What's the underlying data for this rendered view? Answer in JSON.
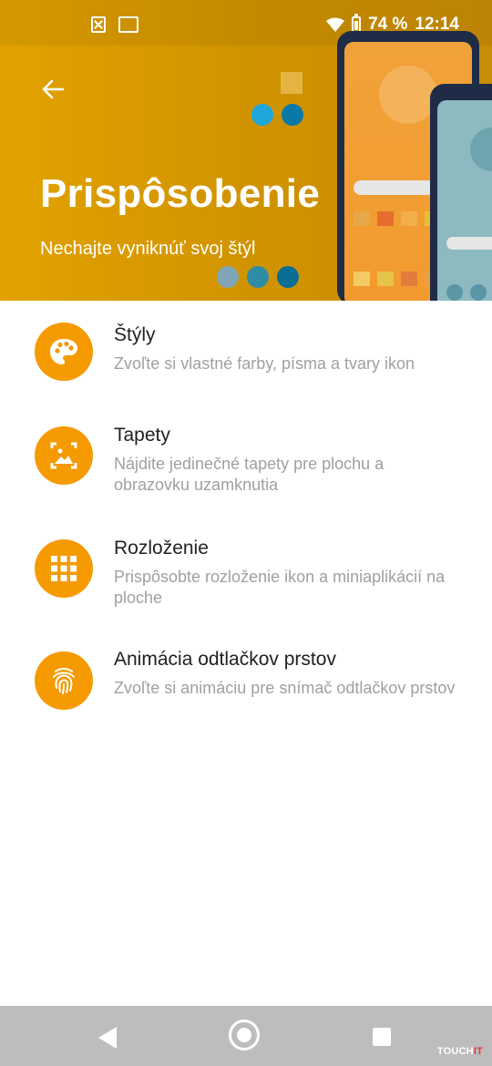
{
  "status": {
    "battery": "74 %",
    "time": "12:14"
  },
  "header": {
    "title": "Prispôsobenie",
    "subtitle": "Nechajte vyniknúť svoj štýl"
  },
  "items": [
    {
      "title": "Štýly",
      "desc": "Zvoľte si vlastné farby, písma a tvary ikon",
      "icon": "palette-icon"
    },
    {
      "title": "Tapety",
      "desc": "Nájdite jedinečné tapety pre plochu a obrazovku uzamknutia",
      "icon": "wallpaper-icon"
    },
    {
      "title": "Rozloženie",
      "desc": "Prispôsobte rozloženie ikon a miniaplikácií na ploche",
      "icon": "grid-icon"
    },
    {
      "title": "Animácia odtlačkov prstov",
      "desc": "Zvoľte si animáciu pre snímač odtlačkov prstov",
      "icon": "fingerprint-icon"
    }
  ],
  "watermark": {
    "part1": "TOUCH",
    "part2": "IT"
  },
  "colors": {
    "accent": "#F59A00",
    "header": "#D99A00"
  }
}
